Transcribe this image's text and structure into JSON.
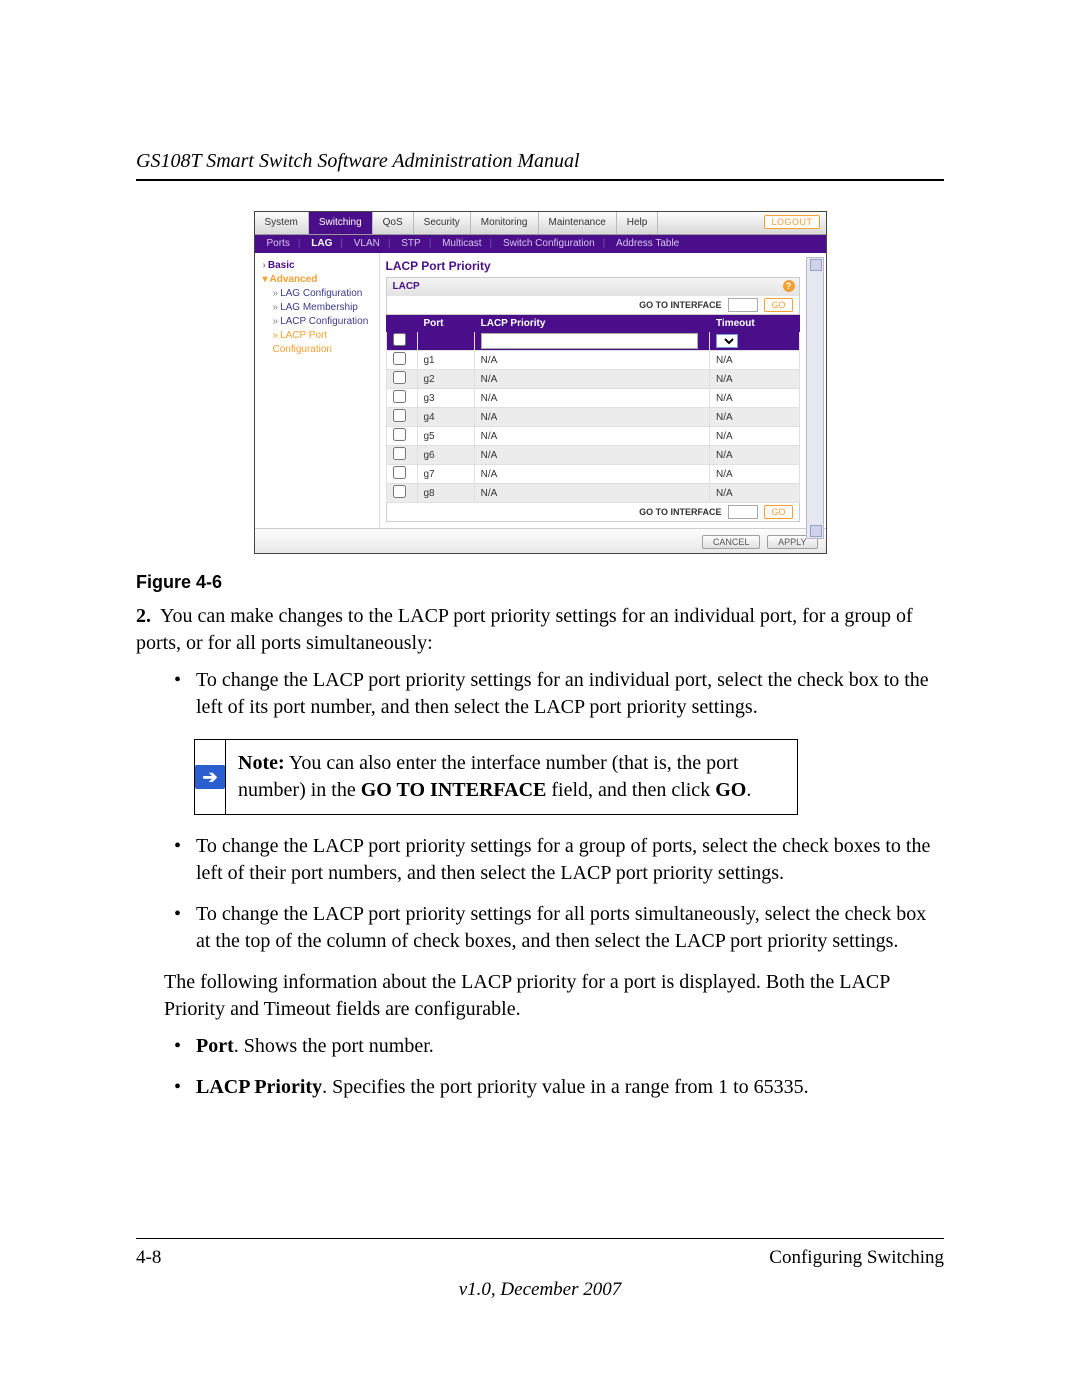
{
  "header": {
    "title": "GS108T Smart Switch Software Administration Manual"
  },
  "figure": {
    "tabs": [
      "System",
      "Switching",
      "QoS",
      "Security",
      "Monitoring",
      "Maintenance",
      "Help"
    ],
    "active_tab": "Switching",
    "logout": "LOGOUT",
    "subtabs": [
      "Ports",
      "LAG",
      "VLAN",
      "STP",
      "Multicast",
      "Switch Configuration",
      "Address Table"
    ],
    "sidebar": {
      "basic": "Basic",
      "advanced": "Advanced",
      "items": [
        "LAG Configuration",
        "LAG Membership",
        "LACP Configuration",
        "LACP Port Configuration"
      ]
    },
    "section_title": "LACP Port Priority",
    "panel_label": "LACP",
    "goto_label": "GO TO INTERFACE",
    "go_label": "GO",
    "columns": {
      "port": "Port",
      "priority": "LACP Priority",
      "timeout": "Timeout"
    },
    "rows": [
      {
        "port": "g1",
        "priority": "N/A",
        "timeout": "N/A"
      },
      {
        "port": "g2",
        "priority": "N/A",
        "timeout": "N/A"
      },
      {
        "port": "g3",
        "priority": "N/A",
        "timeout": "N/A"
      },
      {
        "port": "g4",
        "priority": "N/A",
        "timeout": "N/A"
      },
      {
        "port": "g5",
        "priority": "N/A",
        "timeout": "N/A"
      },
      {
        "port": "g6",
        "priority": "N/A",
        "timeout": "N/A"
      },
      {
        "port": "g7",
        "priority": "N/A",
        "timeout": "N/A"
      },
      {
        "port": "g8",
        "priority": "N/A",
        "timeout": "N/A"
      }
    ],
    "buttons": {
      "cancel": "CANCEL",
      "apply": "APPLY"
    }
  },
  "caption": "Figure 4-6",
  "step2": {
    "num": "2.",
    "text": "You can make changes to the LACP port priority settings for an individual port, for a group of ports, or for all ports simultaneously:"
  },
  "bullets1": [
    "To change the LACP port priority settings for an individual port, select the check box to the left of its port number, and then select the LACP port priority settings."
  ],
  "note": {
    "prefix": "Note:",
    "mid1": " You can also enter the interface number (that is, the port number) in the ",
    "bold1": "GO TO INTERFACE",
    "mid2": " field, and then click ",
    "bold2": "GO",
    "suffix": "."
  },
  "bullets2": [
    "To change the LACP port priority settings for a group of ports, select the check boxes to the left of their port numbers, and then select the LACP port priority settings.",
    "To change the LACP port priority settings for all ports simultaneously, select the check box at the top of the column of check boxes, and then select the LACP port priority settings."
  ],
  "para1": "The following information about the LACP priority for a port is displayed. Both the LACP Priority and Timeout fields are configurable.",
  "defs": [
    {
      "term": "Port",
      "rest": ". Shows the port number."
    },
    {
      "term": "LACP Priority",
      "rest": ". Specifies the port priority value in a range from 1 to 65335."
    }
  ],
  "footer": {
    "page": "4-8",
    "section": "Configuring Switching",
    "version": "v1.0, December 2007"
  }
}
